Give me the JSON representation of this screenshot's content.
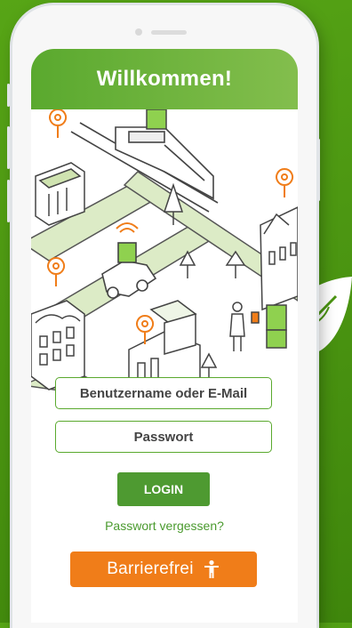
{
  "header": {
    "title": "Willkommen!"
  },
  "form": {
    "username_placeholder": "Benutzername oder E-Mail",
    "password_placeholder": "Passwort",
    "login_label": "LOGIN",
    "forgot_password": "Passwort vergessen?"
  },
  "accessibility": {
    "label": "Barrierefrei",
    "icon": "accessibility-person-icon"
  },
  "colors": {
    "background_green": "#4a9411",
    "header_green": "#6db33f",
    "button_green": "#4e9a31",
    "link_green": "#4a9a2e",
    "orange": "#f07d19"
  },
  "illustration_icons": [
    "location-pin-icon",
    "train-icon",
    "package-icon",
    "wifi-icon",
    "car-icon",
    "tree-icon",
    "solar-panel-icon",
    "person-icon"
  ]
}
